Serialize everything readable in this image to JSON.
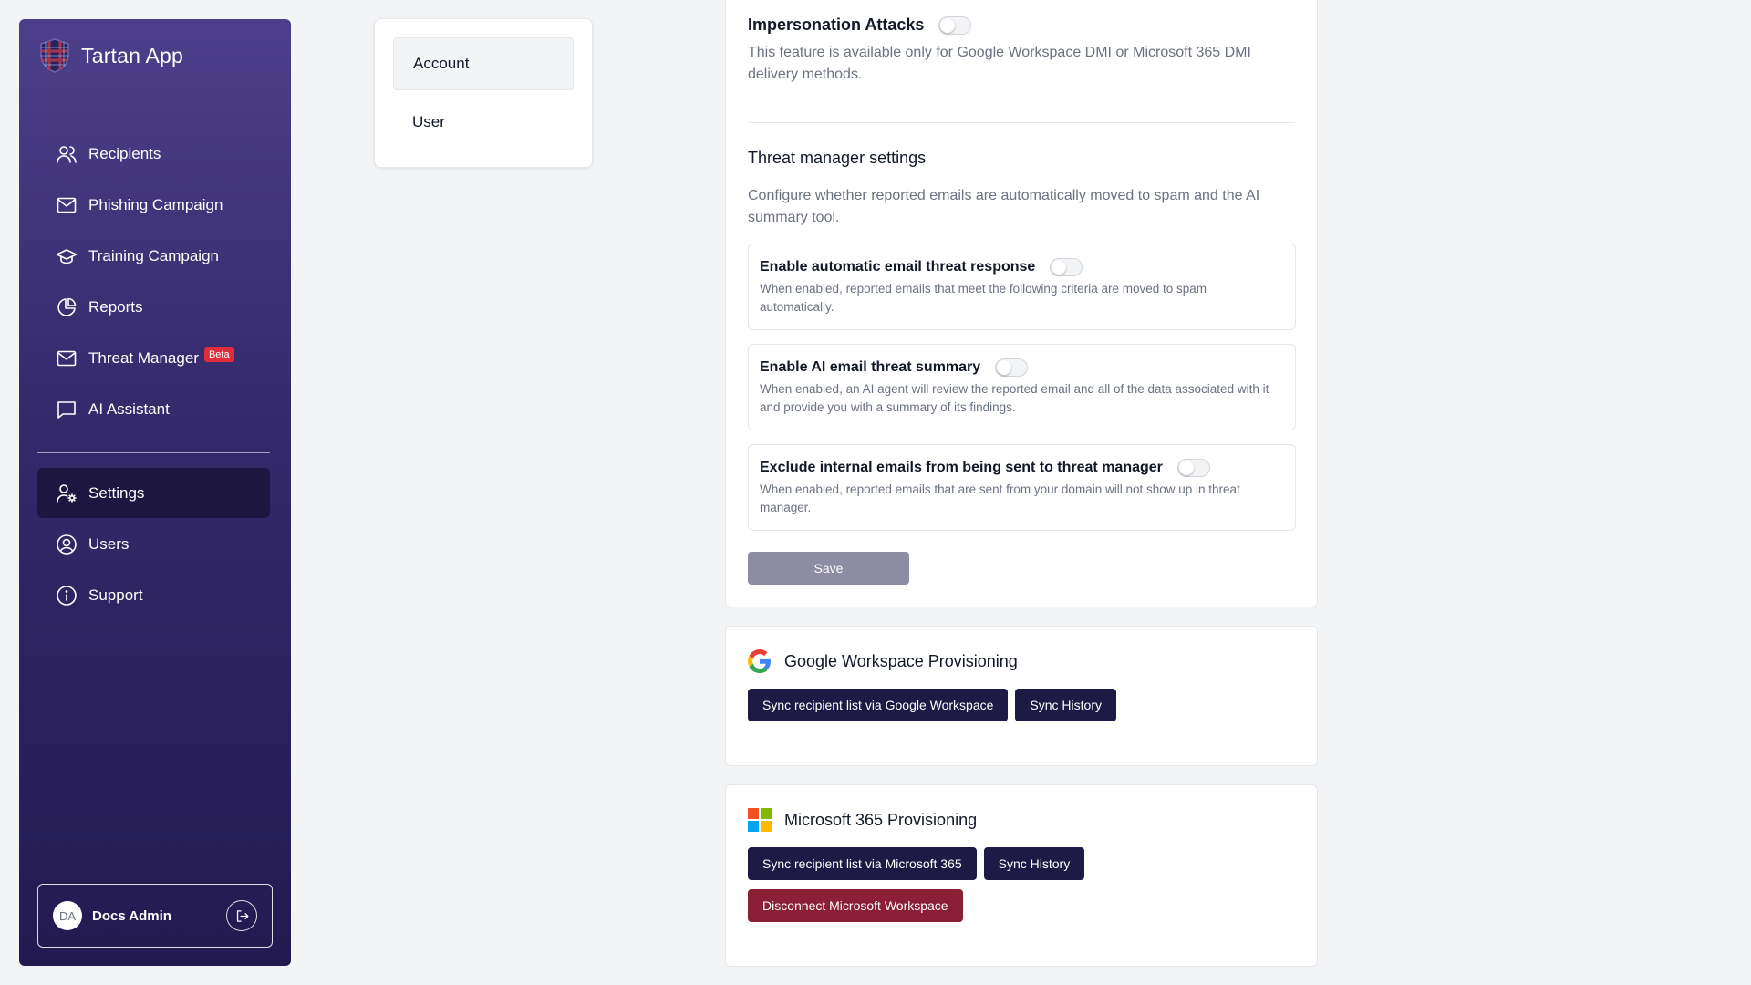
{
  "sidebar": {
    "brand": "Tartan App",
    "items": [
      {
        "label": "Recipients"
      },
      {
        "label": "Phishing Campaign"
      },
      {
        "label": "Training Campaign"
      },
      {
        "label": "Reports"
      },
      {
        "label": "Threat Manager",
        "badge": "Beta"
      },
      {
        "label": "AI Assistant"
      },
      {
        "label": "Settings",
        "active": true
      },
      {
        "label": "Users"
      },
      {
        "label": "Support"
      }
    ],
    "user": {
      "initials": "DA",
      "name": "Docs Admin"
    }
  },
  "subnav": {
    "items": [
      {
        "label": "Account",
        "active": true
      },
      {
        "label": "User"
      }
    ]
  },
  "threat": {
    "impersonation_title": "Impersonation Attacks",
    "impersonation_desc": "This feature is available only for Google Workspace DMI or Microsoft 365 DMI delivery methods.",
    "section_title": "Threat manager settings",
    "section_desc": "Configure whether reported emails are automatically moved to spam and the AI summary tool.",
    "options": [
      {
        "title": "Enable automatic email threat response",
        "desc": "When enabled, reported emails that meet the following criteria are moved to spam automatically.",
        "enabled": false
      },
      {
        "title": "Enable AI email threat summary",
        "desc": "When enabled, an AI agent will review the reported email and all of the data associated with it and provide you with a summary of its findings.",
        "enabled": false
      },
      {
        "title": "Exclude internal emails from being sent to threat manager",
        "desc": "When enabled, reported emails that are sent from your domain will not show up in threat manager.",
        "enabled": false
      }
    ],
    "save_label": "Save"
  },
  "google": {
    "title": "Google Workspace Provisioning",
    "sync_label": "Sync recipient list via Google Workspace",
    "history_label": "Sync History"
  },
  "microsoft": {
    "title": "Microsoft 365 Provisioning",
    "sync_label": "Sync recipient list via Microsoft 365",
    "history_label": "Sync History",
    "disconnect_label": "Disconnect Microsoft Workspace"
  },
  "colors": {
    "sidebar_top": "#4d3f8a",
    "sidebar_bottom": "#221a4f",
    "primary_button": "#1e1a46",
    "danger_button": "#8b1f35",
    "beta_badge": "#e02d3c"
  }
}
